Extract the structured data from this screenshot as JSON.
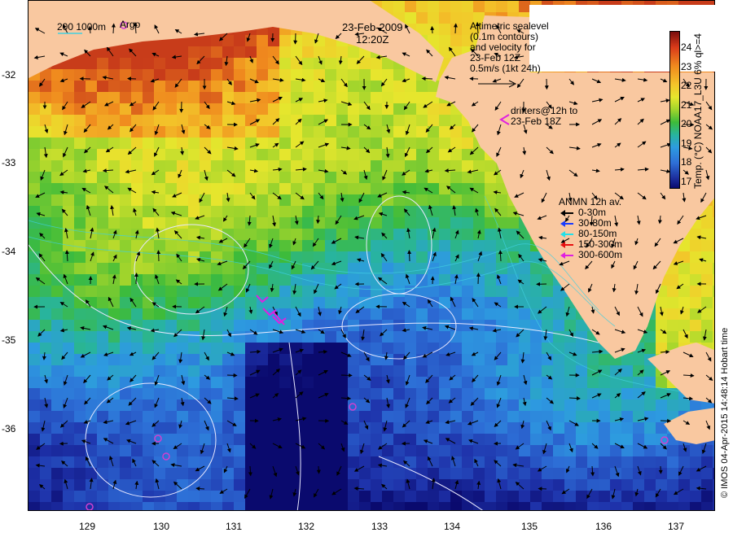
{
  "map": {
    "date": "23-Feb-2009",
    "time": "12:20Z",
    "sealevel_note": [
      "Altimetric sealevel",
      "(0.1m contours)",
      "and velocity for",
      "23-Feb 12Z",
      "0.5m/s (1kt 24h)"
    ],
    "drifter_note": [
      "drifters@12h to",
      "23-Feb 18Z"
    ],
    "scale_bar_label": "200  1000m",
    "argo_label": "Argo",
    "anmn_title": "ANMN 12h av.",
    "anmn_legend": [
      {
        "label": "0-30m",
        "color": "#000000"
      },
      {
        "label": "30-80m",
        "color": "#1a3cff"
      },
      {
        "label": "80-150m",
        "color": "#22e0e8"
      },
      {
        "label": "150-300m",
        "color": "#e81010"
      },
      {
        "label": "300-600m",
        "color": "#e020e0"
      }
    ],
    "colorbar_label": "Temp. (°C) NOAA17_L3U 6% ql>=4",
    "colorbar_ticks": [
      "24",
      "23",
      "22",
      "21",
      "20",
      "19",
      "18",
      "17"
    ],
    "credit": "© IMOS 04-Apr-2015 14:48:14 Hobart time",
    "colors": {
      "land": "#f9c8a0",
      "drifter": "#e020e0",
      "argo": "#d040d0",
      "contour": "#e8e8ff",
      "isobath": "#40d0e0"
    }
  },
  "axes": {
    "x_ticks": [
      "129",
      "130",
      "131",
      "132",
      "133",
      "134",
      "135",
      "136",
      "137"
    ],
    "y_ticks": [
      "-32",
      "-33",
      "-34",
      "-35",
      "-36"
    ],
    "x_range": [
      128.2,
      137.5
    ],
    "y_range": [
      -31.2,
      -36.9
    ]
  }
}
